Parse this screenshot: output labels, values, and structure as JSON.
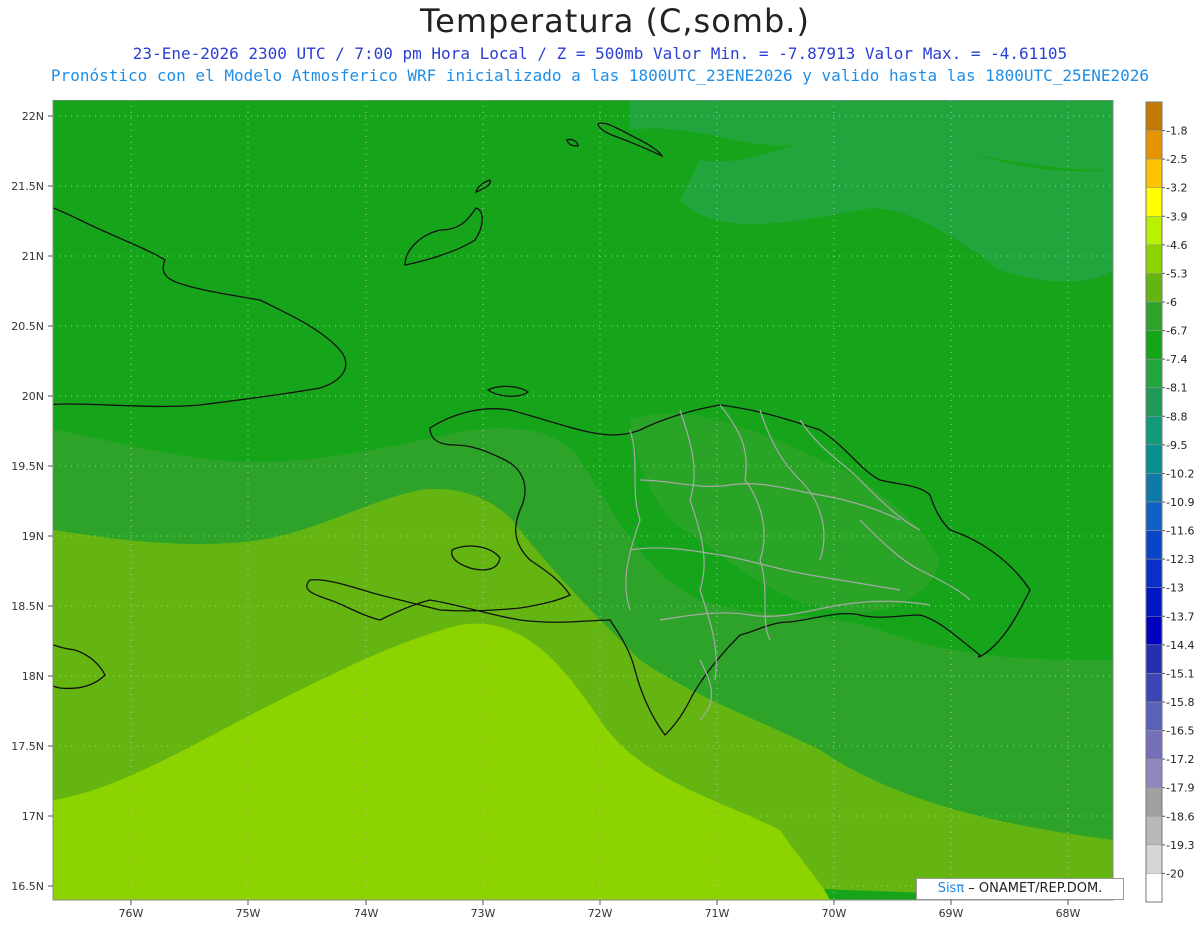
{
  "header": {
    "title": "Temperatura (C,somb.)",
    "line1": "23-Ene-2026  2300 UTC / 7:00 pm Hora Local / Z = 500mb  Valor Min. = -7.87913  Valor Max. = -4.61105",
    "line2": "Pronóstico con el Modelo Atmosferico WRF inicializado a las 1800UTC_23ENE2026 y valido hasta las  1800UTC_25ENE2026"
  },
  "map": {
    "lat_labels": [
      "22N",
      "21.5N",
      "21N",
      "20.5N",
      "20N",
      "19.5N",
      "19N",
      "18.5N",
      "18N",
      "17.5N",
      "17N",
      "16.5N"
    ],
    "lon_labels": [
      "76W",
      "75W",
      "74W",
      "73W",
      "72W",
      "71W",
      "70W",
      "69W",
      "68W"
    ],
    "field_colors": {
      "band_-6.7": "#16a51a",
      "band_-6": "#2ea32a",
      "band_-5.3": "#64b511",
      "band_-4.6": "#8dd300",
      "band_-7.4": "#23a53e"
    }
  },
  "credit": {
    "sis": "Sisπ",
    "rest": " – ONAMET/REP.DOM."
  },
  "colorbar": {
    "levels": [
      {
        "label": "-1.8",
        "color": "#c47a00"
      },
      {
        "label": "-2.5",
        "color": "#e69500"
      },
      {
        "label": "-3.2",
        "color": "#ffc400"
      },
      {
        "label": "-3.9",
        "color": "#ffff00"
      },
      {
        "label": "-4.6",
        "color": "#b9f200"
      },
      {
        "label": "-5.3",
        "color": "#8dd300"
      },
      {
        "label": "-6",
        "color": "#64b511"
      },
      {
        "label": "-6.7",
        "color": "#2ea32a"
      },
      {
        "label": "-7.4",
        "color": "#16a51a"
      },
      {
        "label": "-8.1",
        "color": "#23a53e"
      },
      {
        "label": "-8.8",
        "color": "#1f9a58"
      },
      {
        "label": "-9.5",
        "color": "#139a7a"
      },
      {
        "label": "-10.2",
        "color": "#0a8f90"
      },
      {
        "label": "-10.9",
        "color": "#0f7aa8"
      },
      {
        "label": "-11.6",
        "color": "#0f62c4"
      },
      {
        "label": "-12.3",
        "color": "#0a45c8"
      },
      {
        "label": "-13",
        "color": "#0a2fc8"
      },
      {
        "label": "-13.7",
        "color": "#0015c4"
      },
      {
        "label": "-14.4",
        "color": "#0000bf"
      },
      {
        "label": "-15.1",
        "color": "#2430b0"
      },
      {
        "label": "-15.8",
        "color": "#3c45b5"
      },
      {
        "label": "-16.5",
        "color": "#5a62b8"
      },
      {
        "label": "-17.2",
        "color": "#766fba"
      },
      {
        "label": "-17.9",
        "color": "#8f86be"
      },
      {
        "label": "-18.6",
        "color": "#a0a0a0"
      },
      {
        "label": "-19.3",
        "color": "#b8b8b8"
      },
      {
        "label": "-20",
        "color": "#d6d6d6"
      },
      {
        "label": "",
        "color": "#ffffff"
      }
    ]
  }
}
